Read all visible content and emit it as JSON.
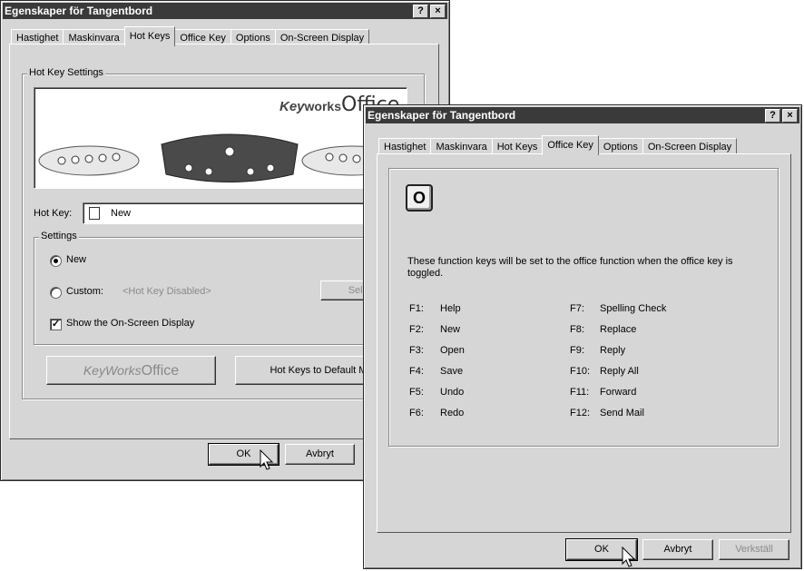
{
  "back_window": {
    "title": "Egenskaper för Tangentbord",
    "title_buttons": [
      "?",
      "×"
    ],
    "tabs": [
      "Hastighet",
      "Maskinvara",
      "Hot Keys",
      "Office Key",
      "Options",
      "On-Screen Display"
    ],
    "active_tab": "Hot Keys",
    "group_label": "Hot Key Settings",
    "logo_key": "Key",
    "logo_works": "works",
    "logo_office": "ffice",
    "hotkey_label": "Hot Key:",
    "hotkey_value": "New",
    "settings_label": "Settings",
    "radio_new": "New",
    "radio_custom": "Custom:",
    "custom_value": "<Hot Key Disabled>",
    "select_button": "Select",
    "show_osd": "Show the On-Screen Display",
    "keyworks_button_key": "Key",
    "keyworks_button_works": "Works",
    "keyworks_button_office": "ffice",
    "default_button": "Hot Keys to  Default Mo",
    "ok": "OK",
    "cancel": "Avbryt"
  },
  "front_window": {
    "title": "Egenskaper för Tangentbord",
    "title_buttons": [
      "?",
      "×"
    ],
    "tabs": [
      "Hastighet",
      "Maskinvara",
      "Hot Keys",
      "Office Key",
      "Options",
      "On-Screen Display"
    ],
    "active_tab": "Office Key",
    "office_key_glyph": "O",
    "description": "These function keys will be set to the office function when the office key is toggled.",
    "function_keys_left": [
      {
        "key": "F1:",
        "action": "Help"
      },
      {
        "key": "F2:",
        "action": "New"
      },
      {
        "key": "F3:",
        "action": "Open"
      },
      {
        "key": "F4:",
        "action": "Save"
      },
      {
        "key": "F5:",
        "action": "Undo"
      },
      {
        "key": "F6:",
        "action": "Redo"
      }
    ],
    "function_keys_right": [
      {
        "key": "F7:",
        "action": "Spelling Check"
      },
      {
        "key": "F8:",
        "action": "Replace"
      },
      {
        "key": "F9:",
        "action": "Reply"
      },
      {
        "key": "F10:",
        "action": "Reply All"
      },
      {
        "key": "F11:",
        "action": "Forward"
      },
      {
        "key": "F12:",
        "action": "Send Mail"
      }
    ],
    "ok": "OK",
    "cancel": "Avbryt",
    "apply": "Verkställ"
  }
}
